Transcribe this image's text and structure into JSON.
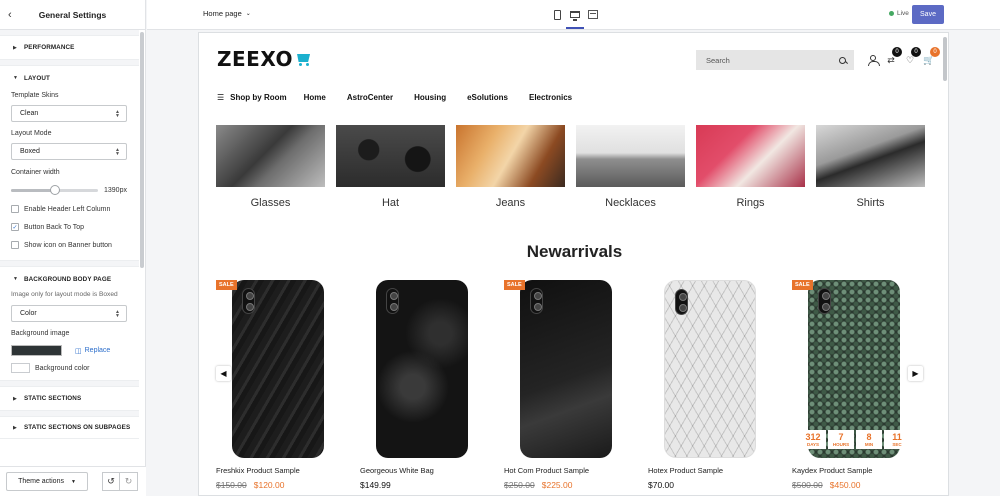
{
  "sidebar": {
    "title": "General Settings",
    "sections": {
      "performance": "PERFORMANCE",
      "layout": "LAYOUT",
      "background": "BACKGROUND BODY PAGE",
      "static": "STATIC SECTIONS",
      "static_sub": "STATIC SECTIONS ON SUBPAGES"
    },
    "template_skins": {
      "label": "Template Skins",
      "value": "Clean"
    },
    "layout_mode": {
      "label": "Layout Mode",
      "value": "Boxed"
    },
    "container_width": {
      "label": "Container width",
      "value": "1390px",
      "fraction": 0.5
    },
    "checks": [
      {
        "label": "Enable Header Left Column",
        "checked": false
      },
      {
        "label": "Button Back To Top",
        "checked": true
      },
      {
        "label": "Show icon on Banner button",
        "checked": false
      }
    ],
    "background_note": "Image only for layout mode is Boxed",
    "background_select": "Color",
    "background_image_label": "Background image",
    "replace_label": "Replace",
    "background_color_label": "Background color",
    "theme_actions": "Theme actions"
  },
  "topbar": {
    "page": "Home page",
    "live": "Live",
    "save": "Save"
  },
  "store": {
    "logo": "ZEEXO",
    "search_placeholder": "Search",
    "badges": {
      "compare": "0",
      "wishlist": "0",
      "cart": "0"
    },
    "nav": [
      "Shop by Room",
      "Home",
      "AstroCenter",
      "Housing",
      "eSolutions",
      "Electronics"
    ],
    "categories": [
      "Glasses",
      "Hat",
      "Jeans",
      "Necklaces",
      "Rings",
      "Shirts"
    ],
    "section_title": "Newarrivals",
    "sale_label": "SALE",
    "products": [
      {
        "name": "Freshkix Product Sample",
        "old_price": "$150.00",
        "price": "$120.00",
        "sale": true
      },
      {
        "name": "Georgeous White Bag",
        "old_price": "",
        "price": "$149.99",
        "sale": false
      },
      {
        "name": "Hot Com Product Sample",
        "old_price": "$250.00",
        "price": "$225.00",
        "sale": true
      },
      {
        "name": "Hotex Product Sample",
        "old_price": "",
        "price": "$70.00",
        "sale": false
      },
      {
        "name": "Kaydex Product Sample",
        "old_price": "$500.00",
        "price": "$450.00",
        "sale": true
      }
    ],
    "countdown": [
      {
        "num": "312",
        "label": "DAYS"
      },
      {
        "num": "7",
        "label": "HOURS"
      },
      {
        "num": "8",
        "label": "MIN"
      },
      {
        "num": "11",
        "label": "SEC"
      }
    ]
  },
  "colors": {
    "accent": "#5c6ac4",
    "sale": "#e8732b",
    "brand": "#1bb0ce"
  }
}
